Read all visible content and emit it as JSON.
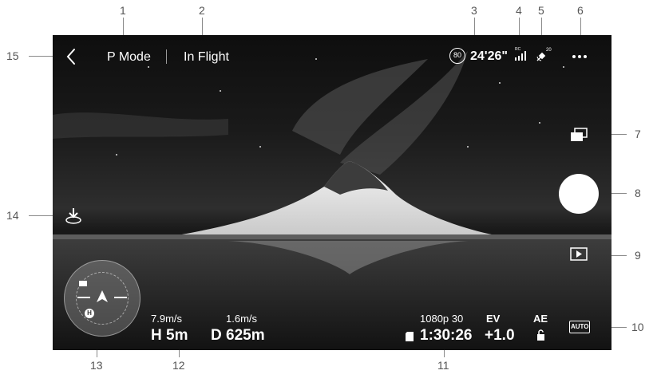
{
  "callouts": [
    "1",
    "2",
    "3",
    "4",
    "5",
    "6",
    "7",
    "8",
    "9",
    "10",
    "11",
    "12",
    "13",
    "14",
    "15"
  ],
  "status_bar": {
    "back_icon": "chevron-left-icon",
    "flight_mode": "P Mode",
    "aircraft_status": "In Flight",
    "battery_percent": "80",
    "flight_time_remaining": "24'26\"",
    "signal_label": "RC",
    "gps_count": "20",
    "more_icon": "ellipsis-icon"
  },
  "right_panel": {
    "switch_icon": "camera-switch-icon",
    "shutter_icon": "shutter-button",
    "playback_icon": "playback-icon",
    "camera_mode": "AUTO"
  },
  "left_panel": {
    "takeoff_icon": "auto-takeoff-icon"
  },
  "telemetry": {
    "horizontal_speed": "7.9m/s",
    "height": "H 5m",
    "vertical_speed": "1.6m/s",
    "distance": "D 625m"
  },
  "camera_info": {
    "resolution": "1080p 30",
    "recording_time": "1:30:26",
    "ev_label": "EV",
    "ev_value": "+1.0",
    "ae_label": "AE"
  },
  "map": {
    "home_label": "H"
  }
}
